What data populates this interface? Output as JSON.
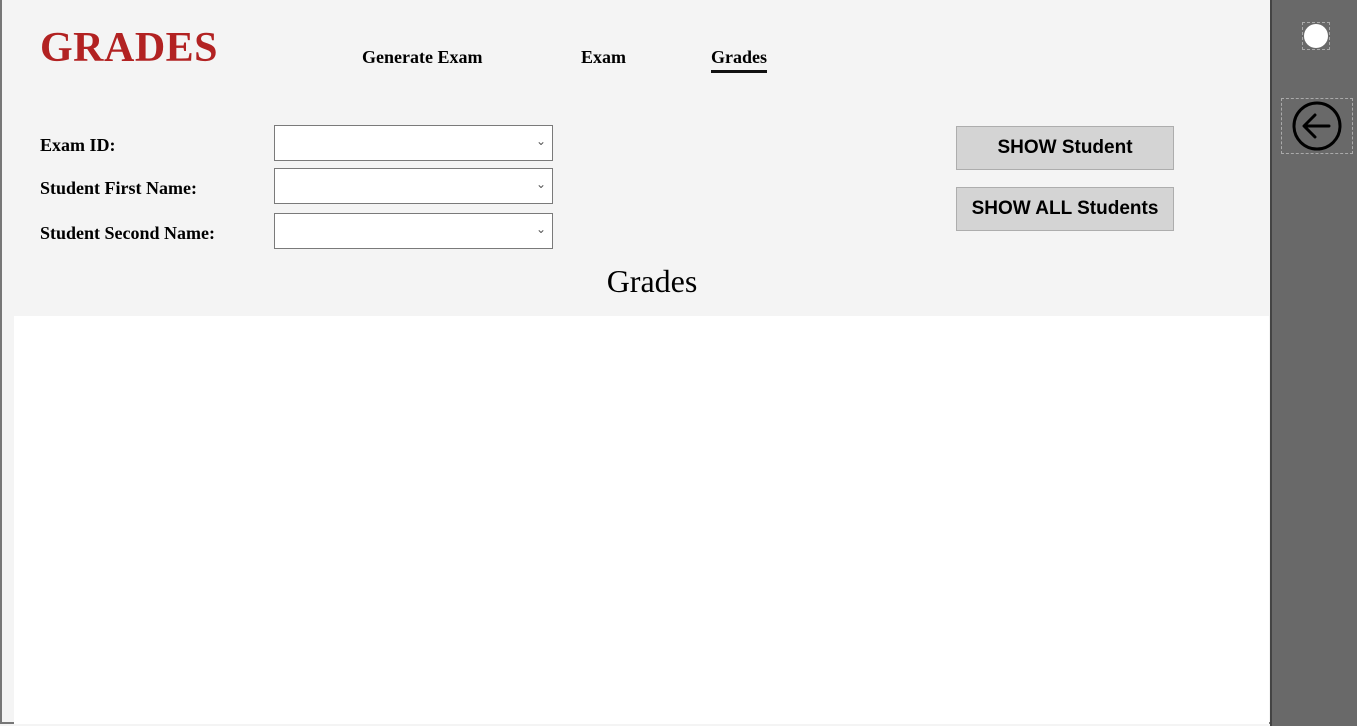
{
  "header": {
    "title": "GRADES"
  },
  "nav": [
    {
      "label": "Generate Exam"
    },
    {
      "label": "Exam"
    },
    {
      "label": "Grades",
      "active": true
    }
  ],
  "form": {
    "exam_id": {
      "label": "Exam ID:",
      "value": ""
    },
    "first_name": {
      "label": "Student First Name:",
      "value": ""
    },
    "second_name": {
      "label": "Student Second Name:",
      "value": ""
    }
  },
  "buttons": {
    "show_student": "SHOW Student",
    "show_all": "SHOW ALL Students"
  },
  "section_heading": "Grades",
  "colors": {
    "title": "#b22222",
    "sidebar": "#696969"
  }
}
